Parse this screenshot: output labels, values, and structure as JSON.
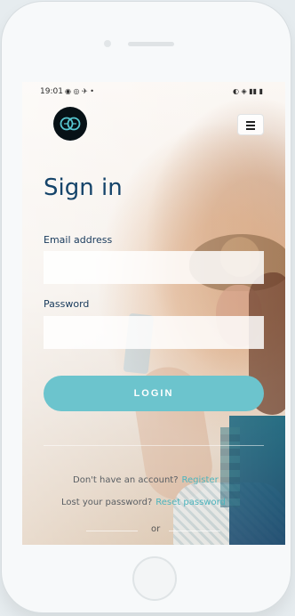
{
  "status_bar": {
    "time": "19:01",
    "left_icons": "◉ ◎ ✈ •",
    "right_icons": "◐ ◈ ▮▮ ▮"
  },
  "header": {
    "logo_alt": "logo",
    "menu_icon": "hamburger-menu-icon"
  },
  "signin": {
    "title": "Sign in",
    "email_label": "Email address",
    "email_value": "",
    "email_placeholder": "",
    "password_label": "Password",
    "password_value": "",
    "password_placeholder": "",
    "login_button": "LOGIN"
  },
  "footer": {
    "register_prompt": "Don't have an account?",
    "register_link": "Register",
    "lost_password_prompt": "Lost your password?",
    "lost_password_link": "Reset password",
    "or_label": "or"
  },
  "colors": {
    "title": "#15446a",
    "accent": "#6cc4cd",
    "link": "#4cb4bd"
  }
}
